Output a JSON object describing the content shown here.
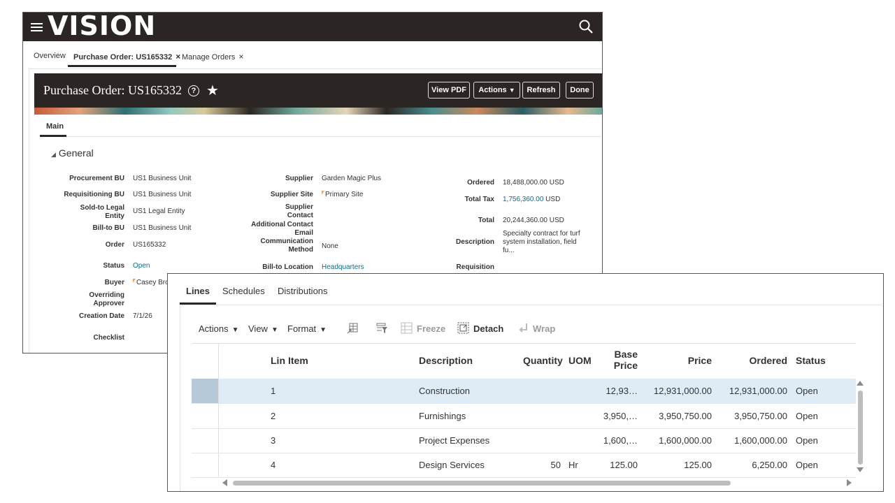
{
  "app": {
    "logo": "VISION",
    "tabs": [
      {
        "label": "Overview"
      },
      {
        "label": "Purchase Order: US165332"
      },
      {
        "label": "Manage Orders"
      }
    ],
    "close_glyph": "×"
  },
  "page": {
    "title": "Purchase Order: US165332",
    "help_glyph": "?",
    "star_glyph": "★",
    "buttons": {
      "view_pdf": "View PDF",
      "actions": "Actions",
      "actions_caret": "▼",
      "refresh": "Refresh",
      "done": "Done"
    },
    "main_tab": "Main",
    "section_title": "General",
    "section_toggle": "◢"
  },
  "general": {
    "col1": [
      {
        "label": "Procurement BU",
        "value": "US1 Business Unit"
      },
      {
        "label": "Requisitioning BU",
        "value": "US1 Business Unit"
      },
      {
        "label": "Sold-to Legal Entity",
        "value": "US1 Legal Entity"
      },
      {
        "label": "Bill-to BU",
        "value": "US1 Business Unit"
      },
      {
        "label": "Order",
        "value": "US165332"
      },
      {
        "label": "Status",
        "value": "Open"
      },
      {
        "label": "Buyer",
        "value": "Casey Bro"
      },
      {
        "label": "Overriding Approver",
        "value": ""
      },
      {
        "label": "Creation Date",
        "value": "7/1/26"
      },
      {
        "label": "Checklist",
        "value": ""
      }
    ],
    "col2": [
      {
        "label": "Supplier",
        "value": "Garden Magic Plus"
      },
      {
        "label": "Supplier Site",
        "value": "Primary Site"
      },
      {
        "label": "Supplier Contact",
        "value": ""
      },
      {
        "label": "Additional Contact Email",
        "value": ""
      },
      {
        "label": "Communication Method",
        "value": "None"
      },
      {
        "label": "Bill-to Location",
        "value": "Headquarters"
      }
    ],
    "col3": [
      {
        "label": "Ordered",
        "value": "18,488,000.00",
        "currency": "USD"
      },
      {
        "label": "Total Tax",
        "value": "1,756,360.00",
        "currency": "USD"
      },
      {
        "label": "Total",
        "value": "20,244,360.00",
        "currency": "USD"
      },
      {
        "label": "Description",
        "value": "Specialty contract for turf system installation, field fu..."
      },
      {
        "label": "Requisition",
        "value": ""
      }
    ]
  },
  "detail": {
    "tabs": [
      "Lines",
      "Schedules",
      "Distributions"
    ],
    "toolbar": {
      "actions": "Actions",
      "view": "View",
      "format": "Format",
      "freeze": "Freeze",
      "detach": "Detach",
      "wrap": "Wrap",
      "caret": "▼"
    },
    "columns": {
      "line": "Lin",
      "item": "Item",
      "description": "Description",
      "quantity": "Quantity",
      "uom": "UOM",
      "base_price_1": "Base",
      "base_price_2": "Price",
      "price": "Price",
      "ordered": "Ordered",
      "status": "Status"
    },
    "rows": [
      {
        "line": "1",
        "item": "",
        "description": "Construction",
        "quantity": "",
        "uom": "",
        "base_price": "12,93…",
        "price": "12,931,000.00",
        "ordered": "12,931,000.00",
        "status": "Open",
        "selected": true
      },
      {
        "line": "2",
        "item": "",
        "description": "Furnishings",
        "quantity": "",
        "uom": "",
        "base_price": "3,950,…",
        "price": "3,950,750.00",
        "ordered": "3,950,750.00",
        "status": "Open",
        "selected": false
      },
      {
        "line": "3",
        "item": "",
        "description": "Project Expenses",
        "quantity": "",
        "uom": "",
        "base_price": "1,600,…",
        "price": "1,600,000.00",
        "ordered": "1,600,000.00",
        "status": "Open",
        "selected": false
      },
      {
        "line": "4",
        "item": "",
        "description": "Design Services",
        "quantity": "50",
        "uom": "Hr",
        "base_price": "125.00",
        "price": "125.00",
        "ordered": "6,250.00",
        "status": "Open",
        "selected": false
      }
    ]
  },
  "colors": {
    "header_dark": "#2b2623",
    "link": "#0b6b8f",
    "selected_row": "#dfecf6",
    "flag": "#f0a56a"
  },
  "icons": [
    "menu-icon",
    "search-icon",
    "help-icon",
    "favorite-star-icon",
    "close-icon",
    "freeze-icon",
    "detach-icon",
    "wrap-icon",
    "add-row-icon",
    "query-filter-icon"
  ]
}
